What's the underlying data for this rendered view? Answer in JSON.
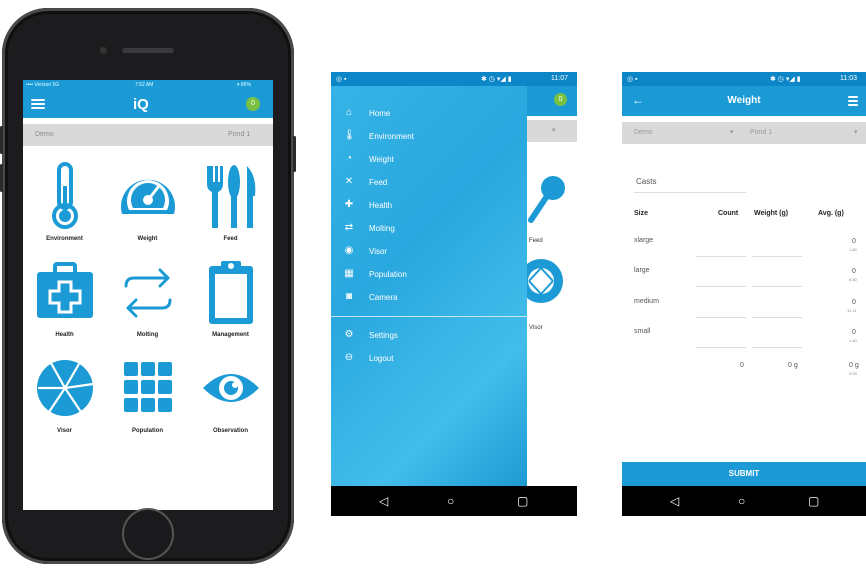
{
  "phone1": {
    "status": {
      "carrier": "•••• Verizon 5G",
      "time": "7:52 AM",
      "battery": "▾ 86%"
    },
    "app_logo": "iQ",
    "badge": "0",
    "selectors": {
      "farm": "Demo",
      "pond": "Pond 1"
    },
    "tiles": [
      {
        "label": "Environment",
        "icon": "thermometer-icon"
      },
      {
        "label": "Weight",
        "icon": "gauge-icon"
      },
      {
        "label": "Feed",
        "icon": "cutlery-icon"
      },
      {
        "label": "Health",
        "icon": "first-aid-kit-icon"
      },
      {
        "label": "Molting",
        "icon": "swap-arrows-icon"
      },
      {
        "label": "Management",
        "icon": "clipboard-icon"
      },
      {
        "label": "Visor",
        "icon": "aperture-icon"
      },
      {
        "label": "Population",
        "icon": "grid-icon"
      },
      {
        "label": "Observation",
        "icon": "eye-icon"
      }
    ]
  },
  "phone2": {
    "status": {
      "time": "11:07",
      "icons": "✱ ◷ ▾◢ ▮"
    },
    "badge": "0",
    "bg_labels": {
      "feed": "Feed",
      "visor": "Visor"
    },
    "menu": [
      {
        "label": "Home",
        "icon": "home-icon"
      },
      {
        "label": "Environment",
        "icon": "thermometer-icon"
      },
      {
        "label": "Weight",
        "icon": "gauge-icon"
      },
      {
        "label": "Feed",
        "icon": "cutlery-icon"
      },
      {
        "label": "Health",
        "icon": "first-aid-kit-icon"
      },
      {
        "label": "Molting",
        "icon": "swap-arrows-icon"
      },
      {
        "label": "Visor",
        "icon": "aperture-icon"
      },
      {
        "label": "Population",
        "icon": "grid-icon"
      },
      {
        "label": "Camera",
        "icon": "camera-icon"
      }
    ],
    "menu_bottom": [
      {
        "label": "Settings",
        "icon": "gear-icon"
      },
      {
        "label": "Logout",
        "icon": "logout-icon"
      }
    ]
  },
  "phone3": {
    "status": {
      "time": "11:03",
      "icons": "✱ ◷ ▾◢ ▮"
    },
    "title": "Weight",
    "selectors": {
      "farm": "Demo",
      "pond": "Pond 1"
    },
    "casts_label": "Casts",
    "columns": [
      "Size",
      "Count",
      "Weight (g)",
      "Avg. (g)"
    ],
    "rows": [
      {
        "size": "xlarge",
        "avg": "0",
        "avg_small": "1.80"
      },
      {
        "size": "large",
        "avg": "0",
        "avg_small": "6.80"
      },
      {
        "size": "medium",
        "avg": "0",
        "avg_small": "11.11"
      },
      {
        "size": "small",
        "avg": "0",
        "avg_small": "1.40"
      }
    ],
    "totals": {
      "count": "0",
      "weight": "0 g",
      "avg": "0 g",
      "avg_small": "3.93"
    },
    "submit_label": "SUBMIT"
  },
  "colors": {
    "brand_blue": "#1b9ad6",
    "status_blue": "#0c86c6",
    "badge_green": "#7ac143",
    "selector_gray": "#d9d9d9"
  }
}
